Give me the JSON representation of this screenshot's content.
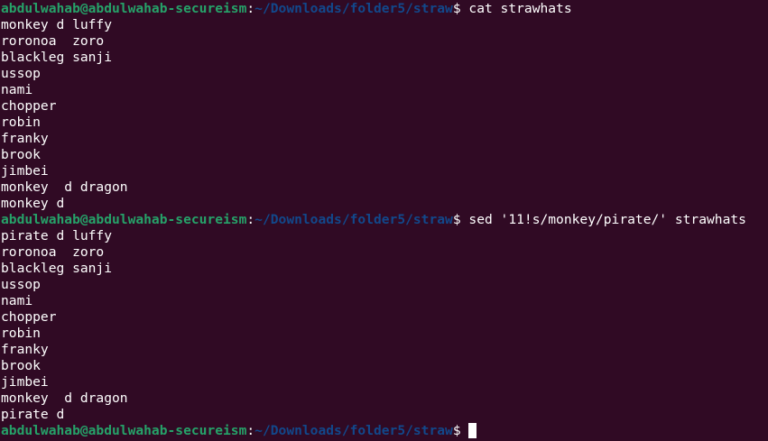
{
  "colors": {
    "background": "#300a24",
    "prompt_user": "#26a269",
    "prompt_path": "#12488b",
    "text": "#ffffff"
  },
  "prompt": {
    "user_host": "abdulwahab@abdulwahab-secureism",
    "colon": ":",
    "path": "~/Downloads/folder5/straw",
    "symbol": "$ "
  },
  "commands": [
    {
      "command": "cat strawhats",
      "output": [
        "monkey d luffy",
        "roronoa  zoro",
        "blackleg sanji",
        "ussop",
        "nami",
        "chopper",
        "robin",
        "franky",
        "brook",
        "jimbei",
        "monkey  d dragon",
        "monkey d"
      ]
    },
    {
      "command": "sed '11!s/monkey/pirate/' strawhats",
      "output": [
        "pirate d luffy",
        "roronoa  zoro",
        "blackleg sanji",
        "ussop",
        "nami",
        "chopper",
        "robin",
        "franky",
        "brook",
        "jimbei",
        "monkey  d dragon",
        "pirate d"
      ]
    }
  ],
  "current_input": ""
}
